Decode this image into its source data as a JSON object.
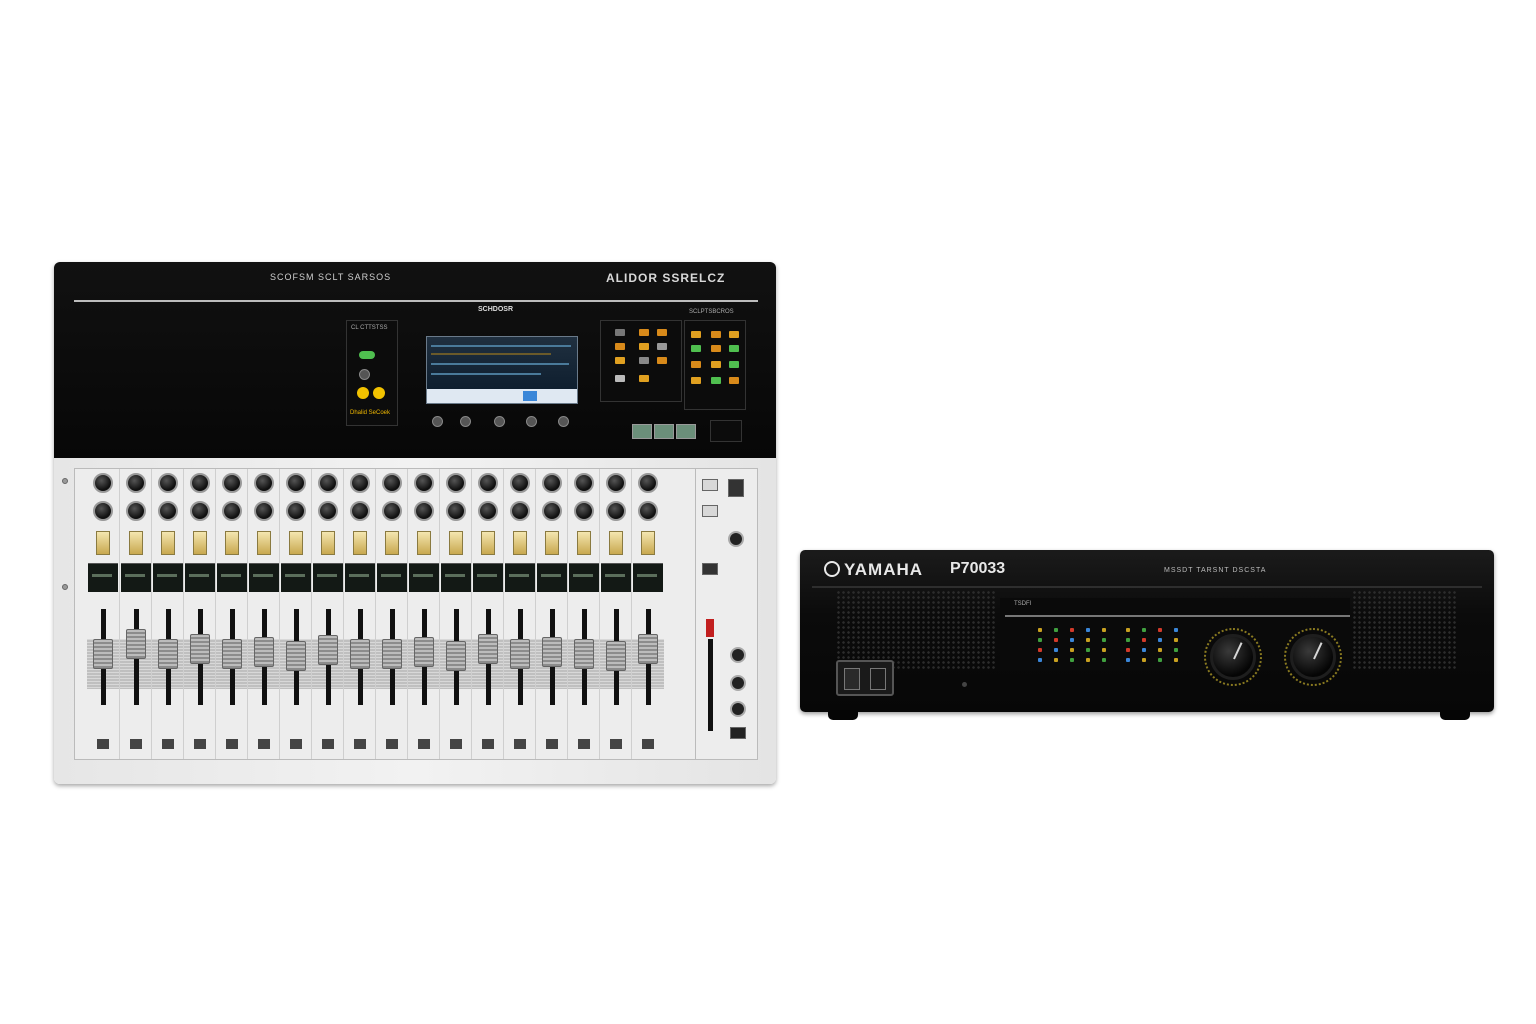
{
  "mixer": {
    "header_left": "SCOFSM   SCLT SARSOS",
    "header_brand": "ALIDOR SSRELCZ",
    "screen_label": "SCHDOSR",
    "panel_label_left": "CL CTTSTSS",
    "panel_label_right": "SCLPTSBCROS",
    "gold_label": "Dhalid SeCoek",
    "channel_count": 18
  },
  "amplifier": {
    "brand": "YAMAHA",
    "model": "P70033",
    "subtitle": "MSSDT TARSNT DSCSTA",
    "display_label": "TSDFI"
  },
  "colors": {
    "select_button": "#d8b75b",
    "green_indicator": "#4fbf4f",
    "amber_indicator": "#f2c200",
    "mute_red": "#c21f1f"
  }
}
